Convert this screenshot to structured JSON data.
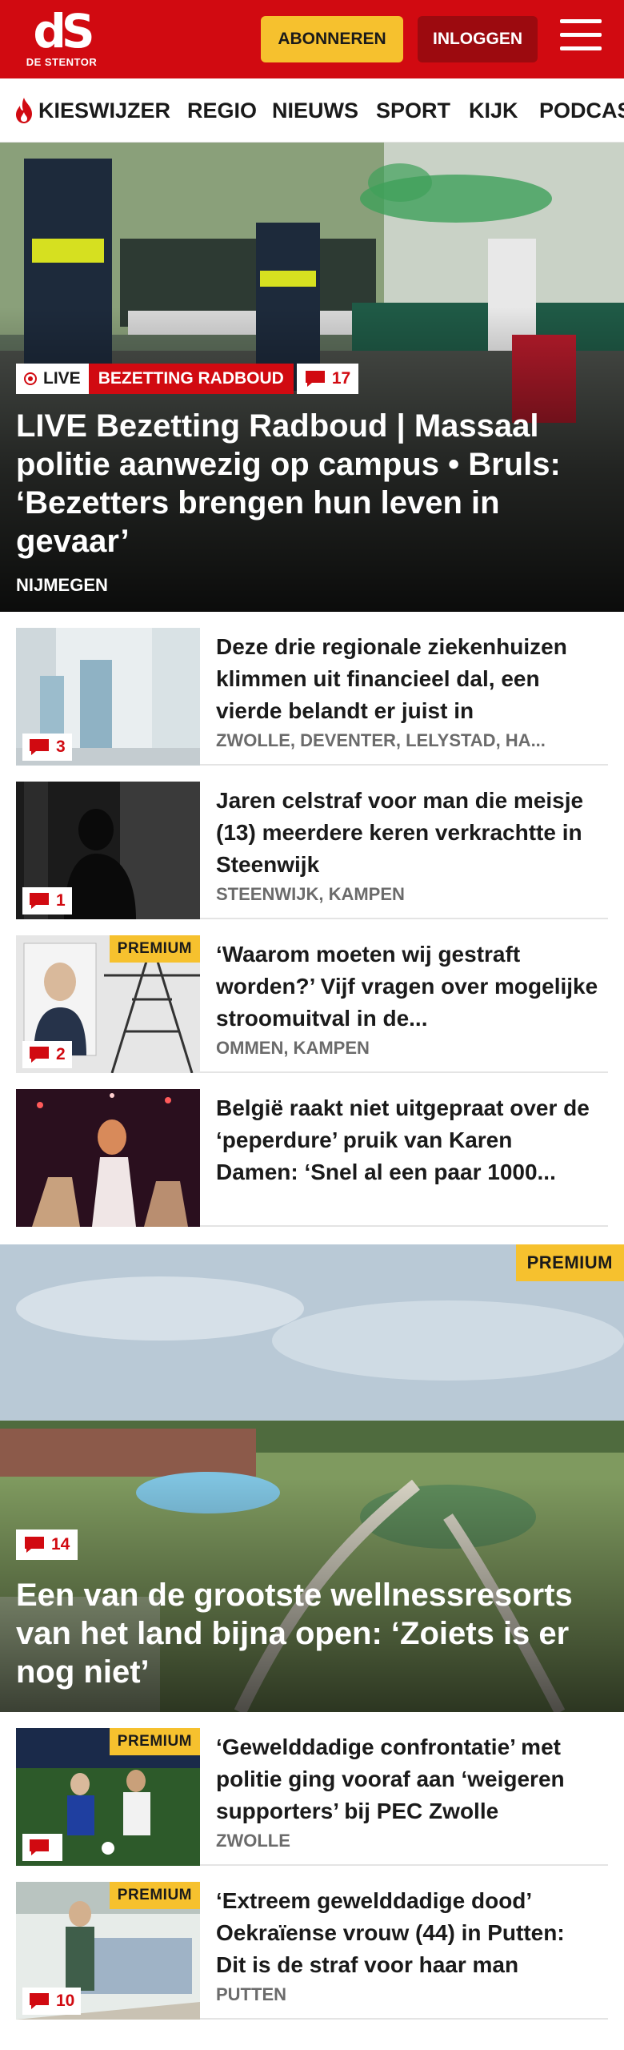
{
  "header": {
    "logo_mark": "dS",
    "logo_sub": "DE STENTOR",
    "subscribe_label": "ABONNEREN",
    "login_label": "INLOGGEN"
  },
  "nav": {
    "items": [
      "KIESWIJZER",
      "REGIO",
      "NIEUWS",
      "SPORT",
      "KIJK",
      "PODCAST"
    ]
  },
  "hero": {
    "live_label": "LIVE",
    "tag": "BEZETTING RADBOUD",
    "comments": "17",
    "title": "LIVE Bezetting Radboud | Massaal politie aanwezig op campus • Bruls: ‘Bezetters brengen hun leven in gevaar’",
    "location": "NIJMEGEN"
  },
  "articles": [
    {
      "title": "Deze drie regionale ziekenhuizen klimmen uit financieel dal, een vierde belandt er juist in",
      "location": "ZWOLLE, DEVENTER, LELYSTAD, HA...",
      "comments": "3",
      "premium": ""
    },
    {
      "title": "Jaren celstraf voor man die meisje (13) meerdere keren verkrachtte in Steenwijk",
      "location": "STEENWIJK, KAMPEN",
      "comments": "1",
      "premium": ""
    },
    {
      "title": "‘Waarom moeten wij gestraft worden?’ Vijf vragen over mogelijke stroomuitval in de...",
      "location": "OMMEN, KAMPEN",
      "comments": "2",
      "premium": "PREMIUM"
    },
    {
      "title": "België raakt niet uitgepraat over de ‘peperdure’ pruik van Karen Damen: ‘Snel al een paar 1000...",
      "location": "",
      "comments": "",
      "premium": ""
    }
  ],
  "feature": {
    "premium": "PREMIUM",
    "comments": "14",
    "title": "Een van de grootste wellnessresorts van het land bijna open: ‘Zoiets is er nog niet’"
  },
  "articles2": [
    {
      "title": "‘Gewelddadige confrontatie’ met politie ging vooraf aan ‘weigeren supporters’ bij PEC Zwolle",
      "location": "ZWOLLE",
      "comments": "",
      "premium": "PREMIUM"
    },
    {
      "title": "‘Extreem gewelddadige dood’ Oekraïense vrouw (44) in Putten: Dit is de straf voor haar man",
      "location": "PUTTEN",
      "comments": "10",
      "premium": "PREMIUM"
    }
  ],
  "colors": {
    "brand_red": "#d10a11",
    "premium_yellow": "#f6c12e",
    "login_dark_red": "#9c0a0f"
  }
}
